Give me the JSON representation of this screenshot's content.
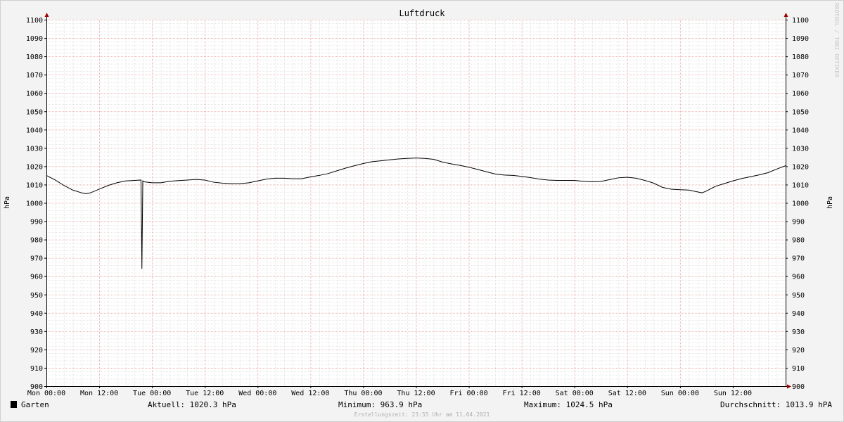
{
  "colors": {
    "background": "#f3f3f3",
    "canvas": "#ffffff",
    "major_grid": "#e8a0a0",
    "minor_grid": "#d8d8d8",
    "axis": "#000000",
    "arrow": "#a00000",
    "line": "#000000",
    "legend_swatch": "#000000"
  },
  "chart_data": {
    "type": "line",
    "title": "Luftdruck",
    "ylabel": "hPa",
    "ylabel_right": "hPa",
    "ylim": [
      900,
      1100
    ],
    "ystep": 10,
    "y_ticks": [
      "1100",
      "1090",
      "1080",
      "1070",
      "1060",
      "1050",
      "1040",
      "1030",
      "1020",
      "1010",
      "1000",
      "990",
      "980",
      "970",
      "960",
      "950",
      "940",
      "930",
      "920",
      "910",
      "900"
    ],
    "xlim_hours": [
      0,
      168
    ],
    "x_ticks": [
      {
        "hour": 0,
        "label": "Mon 00:00"
      },
      {
        "hour": 12,
        "label": "Mon 12:00"
      },
      {
        "hour": 24,
        "label": "Tue 00:00"
      },
      {
        "hour": 36,
        "label": "Tue 12:00"
      },
      {
        "hour": 48,
        "label": "Wed 00:00"
      },
      {
        "hour": 60,
        "label": "Wed 12:00"
      },
      {
        "hour": 72,
        "label": "Thu 00:00"
      },
      {
        "hour": 84,
        "label": "Thu 12:00"
      },
      {
        "hour": 96,
        "label": "Fri 00:00"
      },
      {
        "hour": 108,
        "label": "Fri 12:00"
      },
      {
        "hour": 120,
        "label": "Sat 00:00"
      },
      {
        "hour": 132,
        "label": "Sat 12:00"
      },
      {
        "hour": 144,
        "label": "Sun 00:00"
      },
      {
        "hour": 156,
        "label": "Sun 12:00"
      }
    ],
    "grid": true,
    "series": [
      {
        "name": "Garten",
        "points": [
          [
            0,
            1015
          ],
          [
            2,
            1012.5
          ],
          [
            4,
            1009.5
          ],
          [
            6,
            1007
          ],
          [
            8,
            1005.5
          ],
          [
            9,
            1005
          ],
          [
            10,
            1005.5
          ],
          [
            12,
            1007.5
          ],
          [
            14,
            1009.5
          ],
          [
            16,
            1011
          ],
          [
            18,
            1012
          ],
          [
            20,
            1012.3
          ],
          [
            21.5,
            1012.5
          ],
          [
            21.7,
            964
          ],
          [
            21.9,
            1012
          ],
          [
            22.2,
            1011.5
          ],
          [
            24,
            1011
          ],
          [
            26,
            1011
          ],
          [
            28,
            1011.8
          ],
          [
            30,
            1012.2
          ],
          [
            32,
            1012.5
          ],
          [
            34,
            1012.8
          ],
          [
            36,
            1012.5
          ],
          [
            38,
            1011.3
          ],
          [
            40,
            1010.8
          ],
          [
            42,
            1010.5
          ],
          [
            44,
            1010.5
          ],
          [
            46,
            1011
          ],
          [
            48,
            1012
          ],
          [
            50,
            1013
          ],
          [
            52,
            1013.5
          ],
          [
            54,
            1013.5
          ],
          [
            56,
            1013.2
          ],
          [
            58,
            1013.2
          ],
          [
            60,
            1014.2
          ],
          [
            62,
            1015
          ],
          [
            64,
            1016
          ],
          [
            66,
            1017.5
          ],
          [
            68,
            1019
          ],
          [
            70,
            1020.3
          ],
          [
            72,
            1021.5
          ],
          [
            74,
            1022.5
          ],
          [
            76,
            1023
          ],
          [
            78,
            1023.5
          ],
          [
            80,
            1024
          ],
          [
            82,
            1024.3
          ],
          [
            84,
            1024.5
          ],
          [
            86,
            1024.3
          ],
          [
            88,
            1023.8
          ],
          [
            90,
            1022.3
          ],
          [
            92,
            1021.3
          ],
          [
            94,
            1020.5
          ],
          [
            96,
            1019.5
          ],
          [
            98,
            1018.3
          ],
          [
            100,
            1017
          ],
          [
            102,
            1015.8
          ],
          [
            104,
            1015.2
          ],
          [
            106,
            1015
          ],
          [
            108,
            1014.5
          ],
          [
            110,
            1013.8
          ],
          [
            112,
            1013
          ],
          [
            114,
            1012.5
          ],
          [
            116,
            1012.3
          ],
          [
            118,
            1012.3
          ],
          [
            120,
            1012.3
          ],
          [
            122,
            1011.8
          ],
          [
            124,
            1011.5
          ],
          [
            126,
            1011.7
          ],
          [
            128,
            1012.7
          ],
          [
            130,
            1013.7
          ],
          [
            132,
            1014
          ],
          [
            134,
            1013.5
          ],
          [
            136,
            1012.3
          ],
          [
            138,
            1010.8
          ],
          [
            140,
            1008.5
          ],
          [
            142,
            1007.5
          ],
          [
            144,
            1007.2
          ],
          [
            146,
            1007
          ],
          [
            148,
            1006
          ],
          [
            149,
            1005.5
          ],
          [
            150,
            1006.5
          ],
          [
            152,
            1009
          ],
          [
            154,
            1010.5
          ],
          [
            156,
            1012
          ],
          [
            158,
            1013.3
          ],
          [
            160,
            1014.3
          ],
          [
            162,
            1015.3
          ],
          [
            164,
            1016.5
          ],
          [
            166,
            1018.5
          ],
          [
            168,
            1020.3
          ]
        ]
      }
    ]
  },
  "legend": {
    "series_name": "Garten",
    "current": "Aktuell: 1020.3 hPa",
    "minimum": "Minimum: 963.9 hPa",
    "maximum": "Maximum: 1024.5 hPa",
    "average": "Durchschnitt: 1013.9 hPA"
  },
  "footer": "Erstellungszeit: 23:55 Uhr am 11.04.2021",
  "watermark": "RRDTOOL / TOBI OETIKER"
}
